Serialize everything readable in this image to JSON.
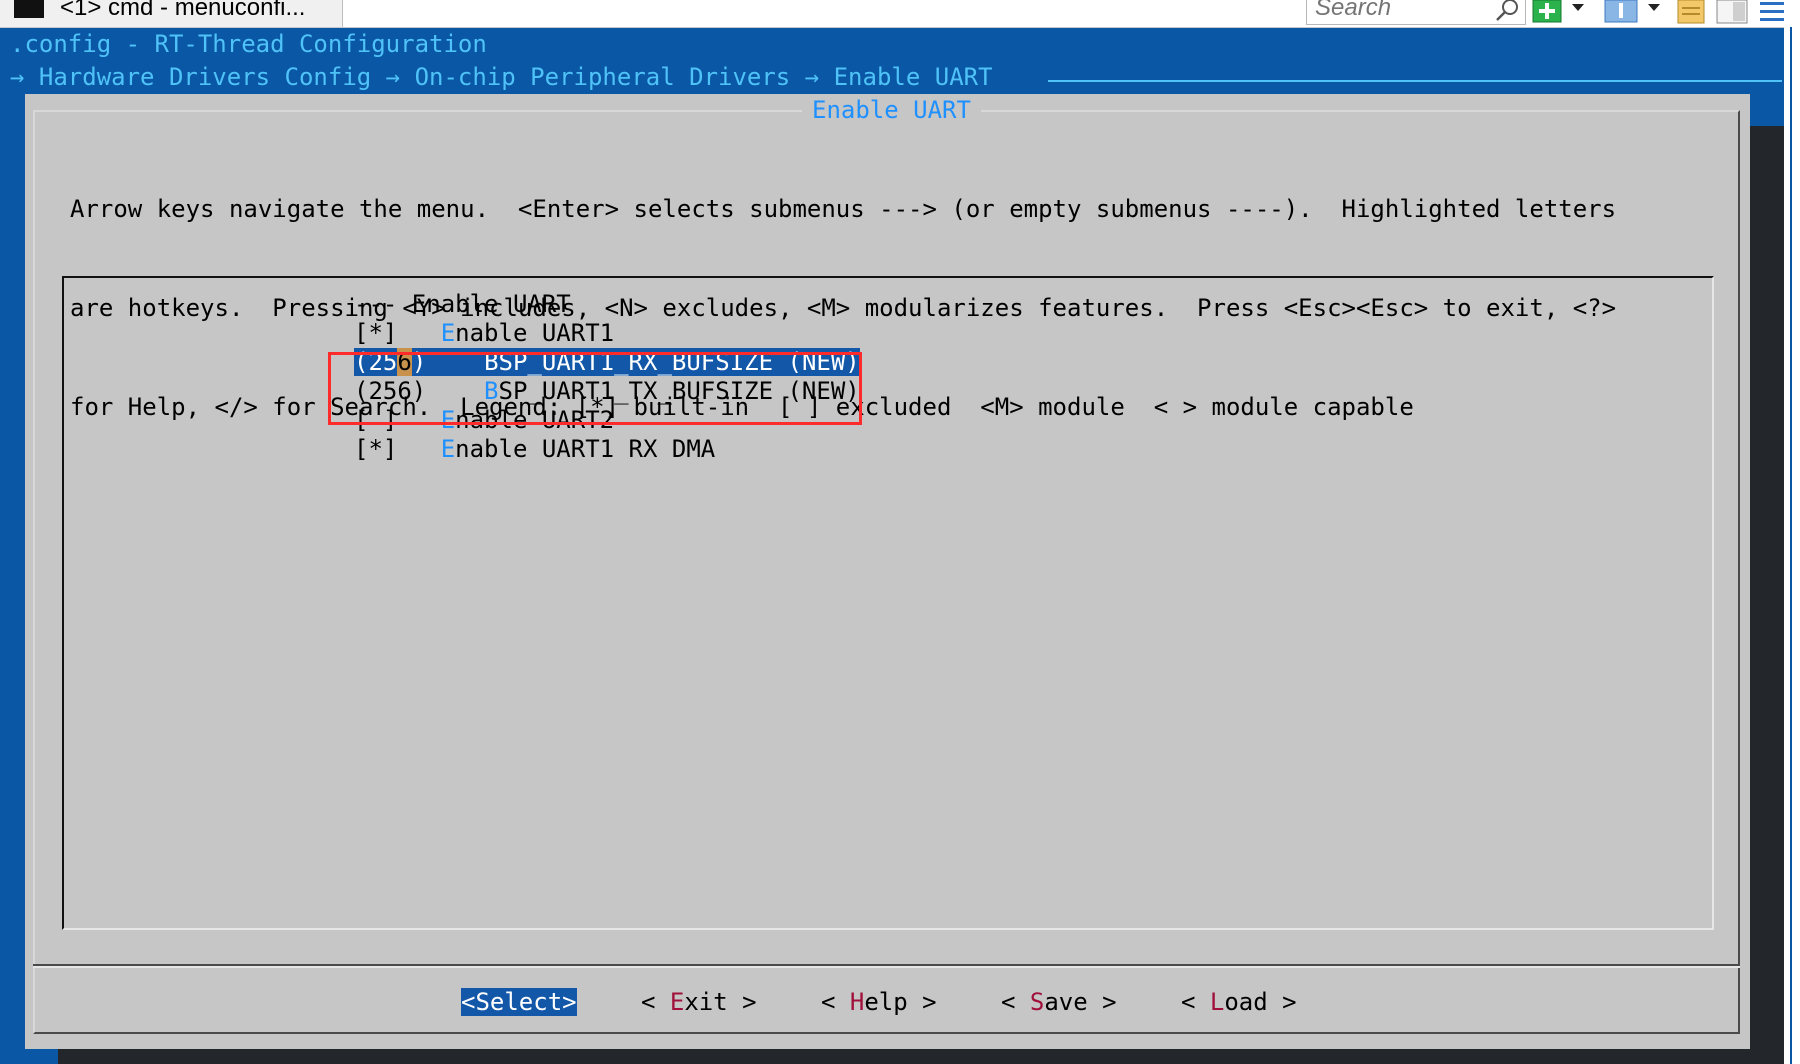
{
  "window": {
    "tab_title": "<1> cmd - menuconfi...",
    "search_placeholder": "Search",
    "toolbar_icons": [
      "search-icon",
      "add-tab-icon",
      "dropdown-arrow-icon",
      "info-icon",
      "dropdown-arrow-icon",
      "notes-icon",
      "panel-icon",
      "menu-icon"
    ]
  },
  "console": {
    "line1": ".config - RT-Thread Configuration",
    "line2": "→ Hardware Drivers Config → On-chip Peripheral Drivers → Enable UART"
  },
  "dialog": {
    "title": "Enable UART",
    "help_lines": [
      "Arrow keys navigate the menu.  <Enter> selects submenus ---> (or empty submenus ----).  Highlighted letters",
      "are hotkeys.  Pressing <Y> includes, <N> excludes, <M> modularizes features.  Press <Esc><Esc> to exit, <?>",
      "for Help, </> for Search.  Legend: [*] built-in  [ ] excluded  <M> module  < > module capable"
    ],
    "items": [
      {
        "prefix": "--- ",
        "hotkey": "",
        "rest": "Enable UART"
      },
      {
        "prefix": "[*]   ",
        "hotkey": "E",
        "rest": "nable UART1"
      },
      {
        "prefix_a": "(25",
        "cursor_char": "6",
        "prefix_b": ")    ",
        "hotkey": "B",
        "rest": "SP_UART1_RX_BUFSIZE (NEW)"
      },
      {
        "prefix": "(256)    ",
        "hotkey": "B",
        "rest": "SP_UART1_TX_BUFSIZE (NEW)"
      },
      {
        "prefix": "[ ]   ",
        "hotkey": "E",
        "rest": "nable UART2"
      },
      {
        "prefix": "[*]   ",
        "hotkey": "E",
        "rest": "nable UART1 RX DMA"
      }
    ],
    "buttons": [
      {
        "left": "<",
        "hotkey": "S",
        "rest": "elect",
        "right": ">"
      },
      {
        "left": "< ",
        "hotkey": "E",
        "rest": "xit",
        "right": " >"
      },
      {
        "left": "< ",
        "hotkey": "H",
        "rest": "elp",
        "right": " >"
      },
      {
        "left": "< ",
        "hotkey": "S",
        "rest": "ave",
        "right": " >"
      },
      {
        "left": "< ",
        "hotkey": "L",
        "rest": "oad",
        "right": " >"
      }
    ]
  },
  "colors": {
    "console_bg": "#0a57a6",
    "dialog_bg": "#c6c6c6",
    "accent_cyan": "#4fc3f7",
    "hotkey_blue": "#1e90ff",
    "selection": "#1257a8",
    "button_hotkey": "#a0103a",
    "highlight_box": "#ff2a2a"
  }
}
